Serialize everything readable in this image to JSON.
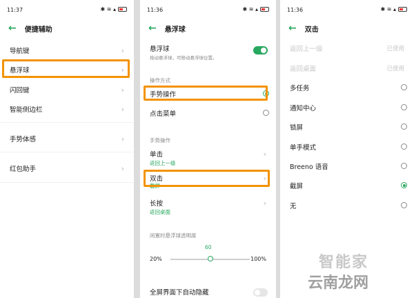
{
  "colors": {
    "accent": "#27a85e",
    "highlight": "#f39200"
  },
  "panel1": {
    "time": "11:37",
    "title": "便捷辅助",
    "items": [
      {
        "label": "导航键"
      },
      {
        "label": "悬浮球"
      },
      {
        "label": "闪回键"
      },
      {
        "label": "智能侧边栏"
      },
      {
        "label": "手势体感"
      },
      {
        "label": "红包助手"
      }
    ]
  },
  "panel2": {
    "time": "11:36",
    "title": "悬浮球",
    "toggle_label": "悬浮球",
    "toggle_desc": "拖动悬浮球，可移动悬浮球位置。",
    "mode_section": "操作方式",
    "mode_gesture": "手势操作",
    "mode_menu": "点击菜单",
    "gesture_section": "手势操作",
    "single_tap": "单击",
    "single_tap_value": "返回上一级",
    "double_tap": "双击",
    "double_tap_value": "截屏",
    "long_press": "长按",
    "long_press_value": "返回桌面",
    "opacity_section": "闲置时悬浮球透明度",
    "opacity_value": "60",
    "opacity_min": "20%",
    "opacity_max": "100%",
    "opacity_fraction": 0.5,
    "fullscreen_hide": "全屏界面下自动隐藏"
  },
  "panel3": {
    "time": "11:36",
    "title": "双击",
    "used_label": "已使用",
    "options": [
      {
        "label": "返回上一级",
        "used": true
      },
      {
        "label": "返回桌面",
        "used": true
      },
      {
        "label": "多任务"
      },
      {
        "label": "通知中心"
      },
      {
        "label": "锁屏"
      },
      {
        "label": "单手模式"
      },
      {
        "label": "Breeno 语音"
      },
      {
        "label": "截屏",
        "selected": true
      },
      {
        "label": "无"
      }
    ]
  },
  "watermark": {
    "line1": "智能家",
    "line2": "云南龙网"
  }
}
